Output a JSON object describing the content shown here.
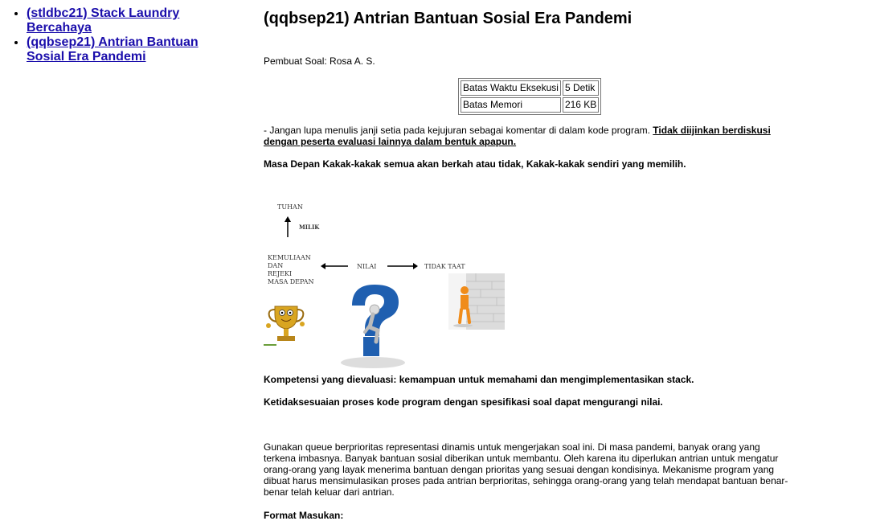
{
  "sidebar": {
    "items": [
      {
        "label": "(stldbc21) Stack Laundry Bercahaya"
      },
      {
        "label": "(qqbsep21) Antrian Bantuan Sosial Era Pandemi"
      }
    ]
  },
  "main": {
    "title": "(qqbsep21) Antrian Bantuan Sosial Era Pandemi",
    "author": "Pembuat Soal: Rosa A. S.",
    "limits": [
      {
        "label": "Batas Waktu Eksekusi",
        "value": "5 Detik"
      },
      {
        "label": "Batas Memori",
        "value": "216 KB"
      }
    ],
    "note_plain": "- Jangan lupa menulis janji setia pada kejujuran sebagai komentar di dalam kode program. ",
    "note_emph": "Tidak diijinkan berdiskusi dengan peserta evaluasi lainnya dalam bentuk apapun.",
    "future": "Masa Depan Kakak-kakak semua akan berkah atau tidak, Kakak-kakak sendiri yang memilih.",
    "diagram": {
      "tuhan": "TUHAN",
      "milik": "MILIK",
      "kemuliaan": [
        "KEMULIAAN",
        "DAN",
        "REJEKI",
        "MASA DEPAN"
      ],
      "nilai": "NILAI",
      "tidak_taat": "TIDAK TAAT"
    },
    "competency": "Kompetensi yang dievaluasi: kemampuan untuk memahami dan mengimplementasikan stack.",
    "mismatch": "Ketidaksesuaian proses kode program dengan spesifikasi soal dapat mengurangi nilai.",
    "description": "Gunakan queue berprioritas representasi dinamis untuk mengerjakan soal ini. Di masa pandemi, banyak orang yang terkena imbasnya. Banyak bantuan sosial diberikan untuk membantu. Oleh karena itu diperlukan antrian untuk mengatur orang-orang yang layak menerima bantuan dengan prioritas yang sesuai dengan kondisinya. Mekanisme program yang dibuat harus mensimulasikan proses pada antrian berprioritas, sehingga orang-orang yang telah mendapat bantuan benar-benar telah keluar dari antrian.",
    "format_heading": "Format Masukan:"
  },
  "colors": {
    "link": "#1a0dab",
    "question_blue": "#1f5fb0",
    "figure_orange": "#f08c1a",
    "trophy_gold": "#d9a520"
  }
}
